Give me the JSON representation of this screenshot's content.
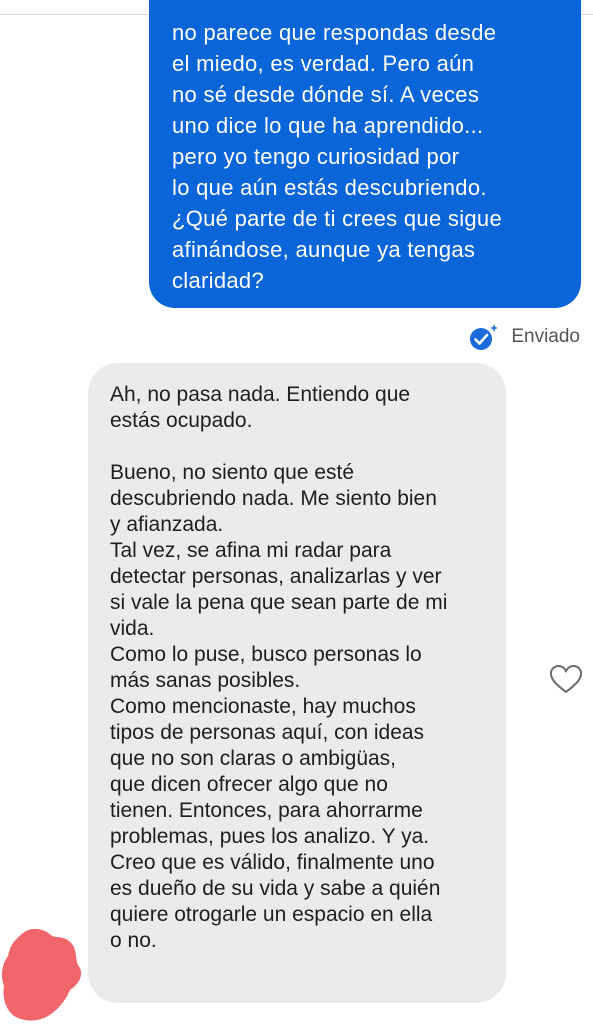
{
  "conversation": {
    "sent_message": {
      "lines": [
        "no parece que respondas desde",
        "el miedo, es verdad. Pero aún",
        "no sé desde dónde sí. A veces",
        "uno dice lo que ha aprendido...",
        "pero yo tengo curiosidad por",
        "lo que aún estás descubriendo.",
        "¿Qué parte de ti crees que sigue",
        "afinándose, aunque ya tengas",
        "claridad?"
      ],
      "status_label": "Enviado",
      "status_icon": "check-circle-icon"
    },
    "received_message": {
      "lines": [
        "Ah, no pasa nada. Entiendo que",
        "estás ocupado.",
        "",
        "Bueno, no siento que esté",
        "descubriendo nada. Me siento bien",
        "y afianzada.",
        "Tal vez, se afina mi radar para",
        "detectar personas, analizarlas y ver",
        "si vale la pena que sean parte de mi",
        "vida.",
        "Como lo puse, busco personas lo",
        "más sanas posibles.",
        "Como mencionaste, hay muchos",
        "tipos de personas aquí, con ideas",
        "que no son claras o ambigüas,",
        "que dicen ofrecer algo que no",
        "tienen. Entonces, para ahorrarme",
        "problemas, pues los analizo. Y ya.",
        "Creo que es válido, finalmente uno",
        "es dueño de su vida y sabe a quién",
        "quiere otrogarle un espacio en ella",
        "o no."
      ],
      "like_icon": "heart-outline-icon"
    }
  },
  "colors": {
    "sent_bubble": "#0a66d8",
    "received_bubble": "#ebebed",
    "status_icon": "#1a6ad9",
    "avatar_redaction": "#f0666a"
  }
}
